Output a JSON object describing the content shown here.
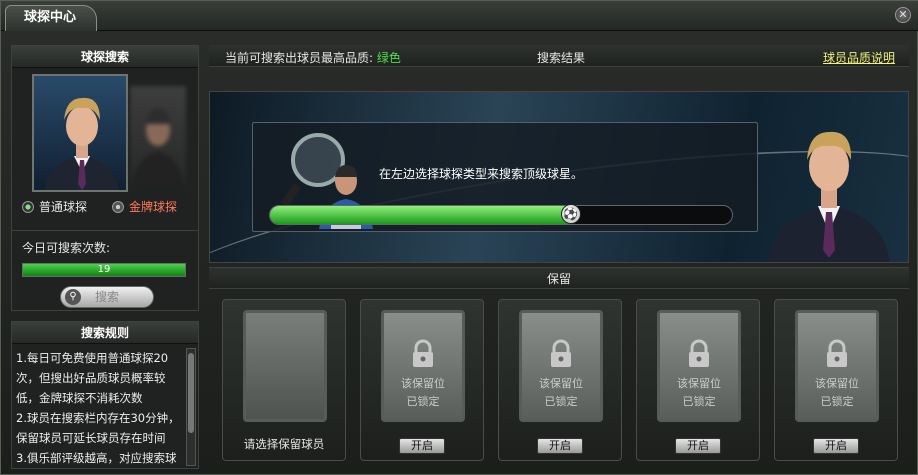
{
  "window": {
    "title": "球探中心",
    "close_icon": "close-icon"
  },
  "left": {
    "header": "球探搜索",
    "radios": [
      {
        "label": "普通球探",
        "selected": true,
        "color": "#ffffff"
      },
      {
        "label": "金牌球探",
        "selected": false,
        "color": "#ff7a5a"
      }
    ],
    "quota_label": "今日可搜索次数:",
    "quota_value": "19",
    "search_button": "搜索"
  },
  "rules": {
    "header": "搜索规则",
    "lines": [
      "1.每日可免费使用普通球探20",
      "次，但搜出好品质球员概率较",
      "低，金牌球探不消耗次数",
      "2.球员在搜索栏内存在30分钟，",
      "保留球员可延长球员存在时间",
      "3.俱乐部评级越高，对应搜索球"
    ]
  },
  "info": {
    "max_quality_label": "当前可搜索出球员最高品质:",
    "max_quality_value": "绿色",
    "result_label": "搜索结果",
    "quality_link": "球员品质说明",
    "quality_color": "#4fe04f"
  },
  "stage": {
    "message": "在左边选择球探类型来搜索顶级球星。",
    "progress": 0.65
  },
  "keep": {
    "label": "保留"
  },
  "slots": [
    {
      "type": "empty",
      "label": "请选择保留球员"
    },
    {
      "type": "locked",
      "line1": "该保留位",
      "line2": "已锁定",
      "button": "开启"
    },
    {
      "type": "locked",
      "line1": "该保留位",
      "line2": "已锁定",
      "button": "开启"
    },
    {
      "type": "locked",
      "line1": "该保留位",
      "line2": "已锁定",
      "button": "开启"
    },
    {
      "type": "locked",
      "line1": "该保留位",
      "line2": "已锁定",
      "button": "开启"
    }
  ]
}
